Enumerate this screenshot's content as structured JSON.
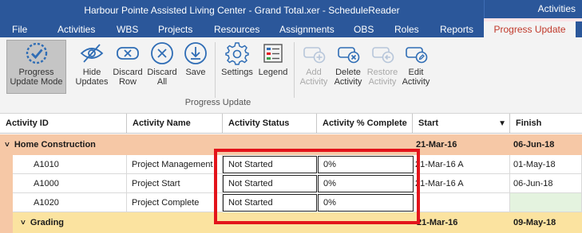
{
  "window": {
    "title": "Harbour Pointe Assisted Living Center - Grand Total.xer - ScheduleReader",
    "context_tab_header": "Activities"
  },
  "menu": {
    "tabs": [
      "File",
      "Activities",
      "WBS",
      "Projects",
      "Resources",
      "Assignments",
      "OBS",
      "Roles",
      "Reports",
      "Progress Update"
    ],
    "active": "Progress Update"
  },
  "ribbon": {
    "group_label": "Progress Update",
    "buttons": {
      "progress_update_mode": "Progress\nUpdate Mode",
      "hide_updates": "Hide\nUpdates",
      "discard_row": "Discard\nRow",
      "discard_all": "Discard\nAll",
      "save": "Save",
      "settings": "Settings",
      "legend": "Legend",
      "add_activity": "Add\nActivity",
      "delete_activity": "Delete\nActivity",
      "restore_activity": "Restore\nActivity",
      "edit_activity": "Edit\nActivity"
    }
  },
  "grid": {
    "columns": [
      "Activity ID",
      "Activity Name",
      "Activity Status",
      "Activity % Complete",
      "Start",
      "Finish"
    ],
    "groups": {
      "home": {
        "name": "Home Construction",
        "start": "21-Mar-16",
        "finish": "06-Jun-18"
      },
      "grading": {
        "name": "Grading",
        "start": "21-Mar-16",
        "finish": "09-May-18"
      }
    },
    "rows": [
      {
        "id": "A1010",
        "name": "Project Management",
        "status": "Not Started",
        "pct": "0%",
        "start": "21-Mar-16 A",
        "finish": "01-May-18"
      },
      {
        "id": "A1000",
        "name": "Project Start",
        "status": "Not Started",
        "pct": "0%",
        "start": "21-Mar-16 A",
        "finish": "06-Jun-18"
      },
      {
        "id": "A1020",
        "name": "Project Complete",
        "status": "Not Started",
        "pct": "0%",
        "start": "",
        "finish": ""
      }
    ]
  },
  "colors": {
    "ribbon_blue": "#2b579a",
    "group_orange": "#f6c8a6",
    "group_yellow": "#fbe3a0",
    "highlight_red": "#e3141b",
    "icon_blue": "#2f6db5"
  }
}
